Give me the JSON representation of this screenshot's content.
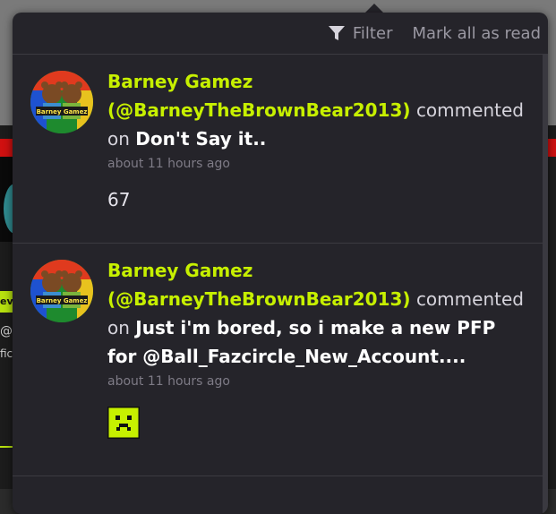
{
  "background": {
    "fragments": [
      "ev",
      "@",
      "fic"
    ]
  },
  "header": {
    "filter_label": "Filter",
    "mark_all_label": "Mark all as read"
  },
  "notifications": [
    {
      "author": "Barney Gamez",
      "handle": "(@BarneyTheBrownBear2013)",
      "action": "commented",
      "preposition": "on",
      "target": "Don't Say it..",
      "time": "about 11 hours ago",
      "body": "67",
      "avatar_text": "Barney Gamez"
    },
    {
      "author": "Barney Gamez",
      "handle": "(@BarneyTheBrownBear2013)",
      "action": "commented",
      "preposition": "on",
      "target": "Just i'm bored, so i make a new PFP for @Ball_Fazcircle_New_Account....",
      "time": "about 11 hours ago",
      "body_emoji": "sad-face-icon",
      "avatar_text": "Barney Gamez"
    }
  ],
  "colors": {
    "accent": "#c7f000",
    "panel": "#25242a",
    "muted": "#9a98a2"
  }
}
